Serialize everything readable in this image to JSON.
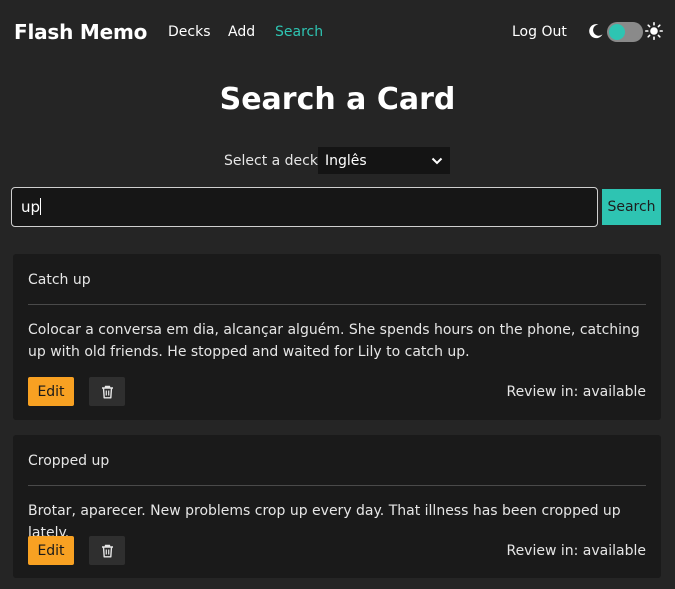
{
  "navbar": {
    "brand": "Flash Memo",
    "links": [
      {
        "label": "Decks"
      },
      {
        "label": "Add"
      },
      {
        "label": "Search",
        "active": true
      }
    ],
    "logout": "Log Out",
    "theme": {
      "mode": "dark",
      "icons": [
        "moon-icon",
        "sun-icon"
      ]
    }
  },
  "page": {
    "title": "Search a Card",
    "deck_label": "Select a deck",
    "deck_selected": "Inglês",
    "search_value": "up",
    "search_button": "Search"
  },
  "cards": [
    {
      "title": "Catch up",
      "body": "Colocar a conversa em dia, alcançar alguém. She spends hours on the phone, catching up with old friends. He stopped and waited for Lily to catch up.",
      "edit_label": "Edit",
      "review": "Review in: available"
    },
    {
      "title": "Cropped up",
      "body": "Brotar, aparecer. New problems crop up every day. That illness has been cropped up lately.",
      "edit_label": "Edit",
      "review": "Review in: available"
    }
  ],
  "colors": {
    "background": "#252525",
    "card": "#1a1a1a",
    "accent": "#2ec4b2",
    "edit": "#f8a122"
  }
}
